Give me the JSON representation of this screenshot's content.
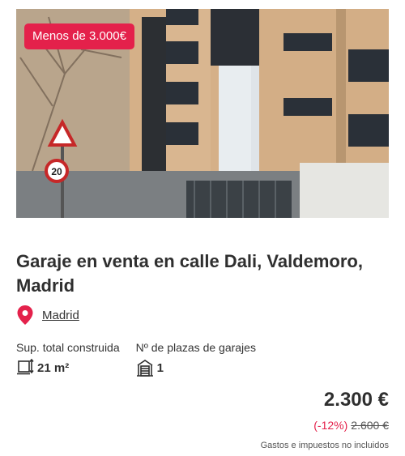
{
  "listing": {
    "badge": "Menos de 3.000€",
    "title": "Garaje en venta en calle Dali, Valdemoro, Madrid",
    "location": "Madrid",
    "features": [
      {
        "label": "Sup. total construida",
        "value": "21 m²",
        "icon": "area-icon"
      },
      {
        "label": "Nº de plazas de garajes",
        "value": "1",
        "icon": "garage-icon"
      }
    ],
    "price": "2.300 €",
    "discount": "(-12%)",
    "old_price": "2.600 €",
    "taxes_note": "Gastos e impuestos no incluidos"
  },
  "photo": {
    "signs": [
      "20"
    ]
  },
  "colors": {
    "accent": "#e4214b",
    "text": "#2f2f2f",
    "brick": "#d7b48c"
  }
}
